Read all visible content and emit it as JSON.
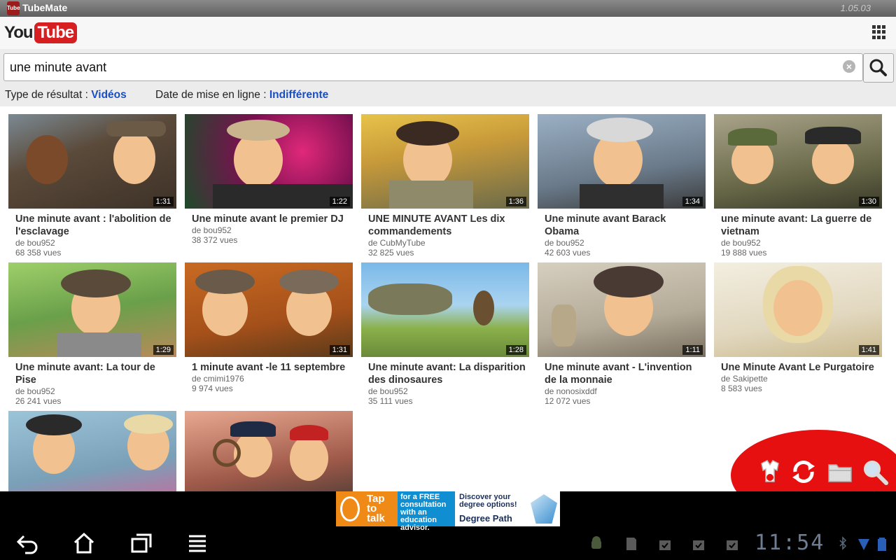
{
  "app": {
    "logo_text": "Tube",
    "name": "TubeMate",
    "version": "1.05.03"
  },
  "youtube": {
    "logo_you": "You",
    "logo_tube": "Tube"
  },
  "search": {
    "query": "une minute avant"
  },
  "filters": {
    "type_label": "Type de résultat :",
    "type_value": "Vidéos",
    "date_label": "Date de mise en ligne :",
    "date_value": "Indifférente"
  },
  "videos": [
    {
      "title": "Une minute avant : l'abolition de l'esclavage",
      "author": "de bou952",
      "views": "68 358 vues",
      "duration": "1:31"
    },
    {
      "title": "Une minute avant le premier DJ",
      "author": "de bou952",
      "views": "38 372 vues",
      "duration": "1:22"
    },
    {
      "title": "UNE MINUTE AVANT Les dix commandements",
      "author": "de CubMyTube",
      "views": "32 825 vues",
      "duration": "1:36"
    },
    {
      "title": "Une minute avant Barack Obama",
      "author": "de bou952",
      "views": "42 603 vues",
      "duration": "1:34"
    },
    {
      "title": "une minute avant: La guerre de vietnam",
      "author": "de bou952",
      "views": "19 888 vues",
      "duration": "1:30"
    },
    {
      "title": "Une minute avant: La tour de Pise",
      "author": "de bou952",
      "views": "26 241 vues",
      "duration": "1:29"
    },
    {
      "title": "1 minute avant -le 11 septembre",
      "author": "de cmimi1976",
      "views": "9 974 vues",
      "duration": "1:31"
    },
    {
      "title": "Une minute avant: La disparition des dinosaures",
      "author": "de bou952",
      "views": "35 111 vues",
      "duration": "1:28"
    },
    {
      "title": "Une minute avant - L'invention de la monnaie",
      "author": "de nonosixddf",
      "views": "12 072 vues",
      "duration": "1:11"
    },
    {
      "title": "Une Minute Avant Le Purgatoire",
      "author": "de Sakipette",
      "views": "8 583 vues",
      "duration": "1:41"
    }
  ],
  "ad": {
    "tap": "Tap to talk",
    "consult": "for a FREE consultation with an education advisor.",
    "degree_tagline": "Discover your degree options!",
    "degree_brand": "Degree Path"
  },
  "status": {
    "time": "11:54"
  },
  "colors": {
    "youtube_red": "#d61f20",
    "link_blue": "#1a4fc4",
    "fab_red": "#e61010",
    "ad_orange": "#f08a16",
    "ad_blue": "#0f8fd2"
  }
}
